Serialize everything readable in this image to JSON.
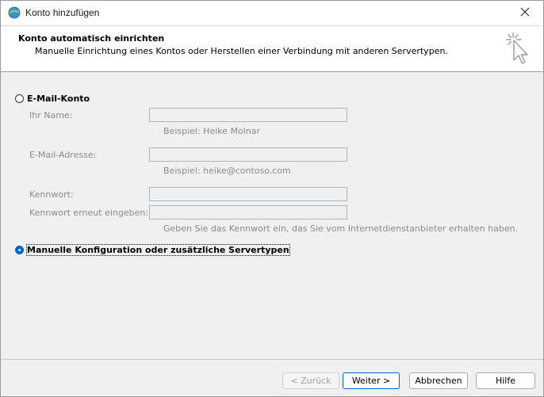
{
  "window": {
    "title": "Konto hinzufügen"
  },
  "header": {
    "title": "Konto automatisch einrichten",
    "subtitle": "Manuelle Einrichtung eines Kontos oder Herstellen einer Verbindung mit anderen Servertypen."
  },
  "email_account": {
    "option_label": "E-Mail-Konto",
    "selected": false,
    "name_label": "Ihr Name:",
    "name_value": "",
    "name_hint": "Beispiel: Heike Molnar",
    "email_label": "E-Mail-Adresse:",
    "email_value": "",
    "email_hint": "Beispiel: heike@contoso.com",
    "password_label": "Kennwort:",
    "password_value": "",
    "password_repeat_label": "Kennwort erneut eingeben:",
    "password_repeat_value": "",
    "password_hint": "Geben Sie das Kennwort ein, das Sie vom Internetdienstanbieter erhalten haben."
  },
  "manual_config": {
    "option_label": "Manuelle Konfiguration oder zusätzliche Servertypen",
    "selected": true
  },
  "buttons": {
    "back": "< Zurück",
    "next": "Weiter >",
    "cancel": "Abbrechen",
    "help": "Hilfe"
  },
  "colors": {
    "accent": "#0067c0",
    "disabled_text": "#8a8a8a"
  }
}
